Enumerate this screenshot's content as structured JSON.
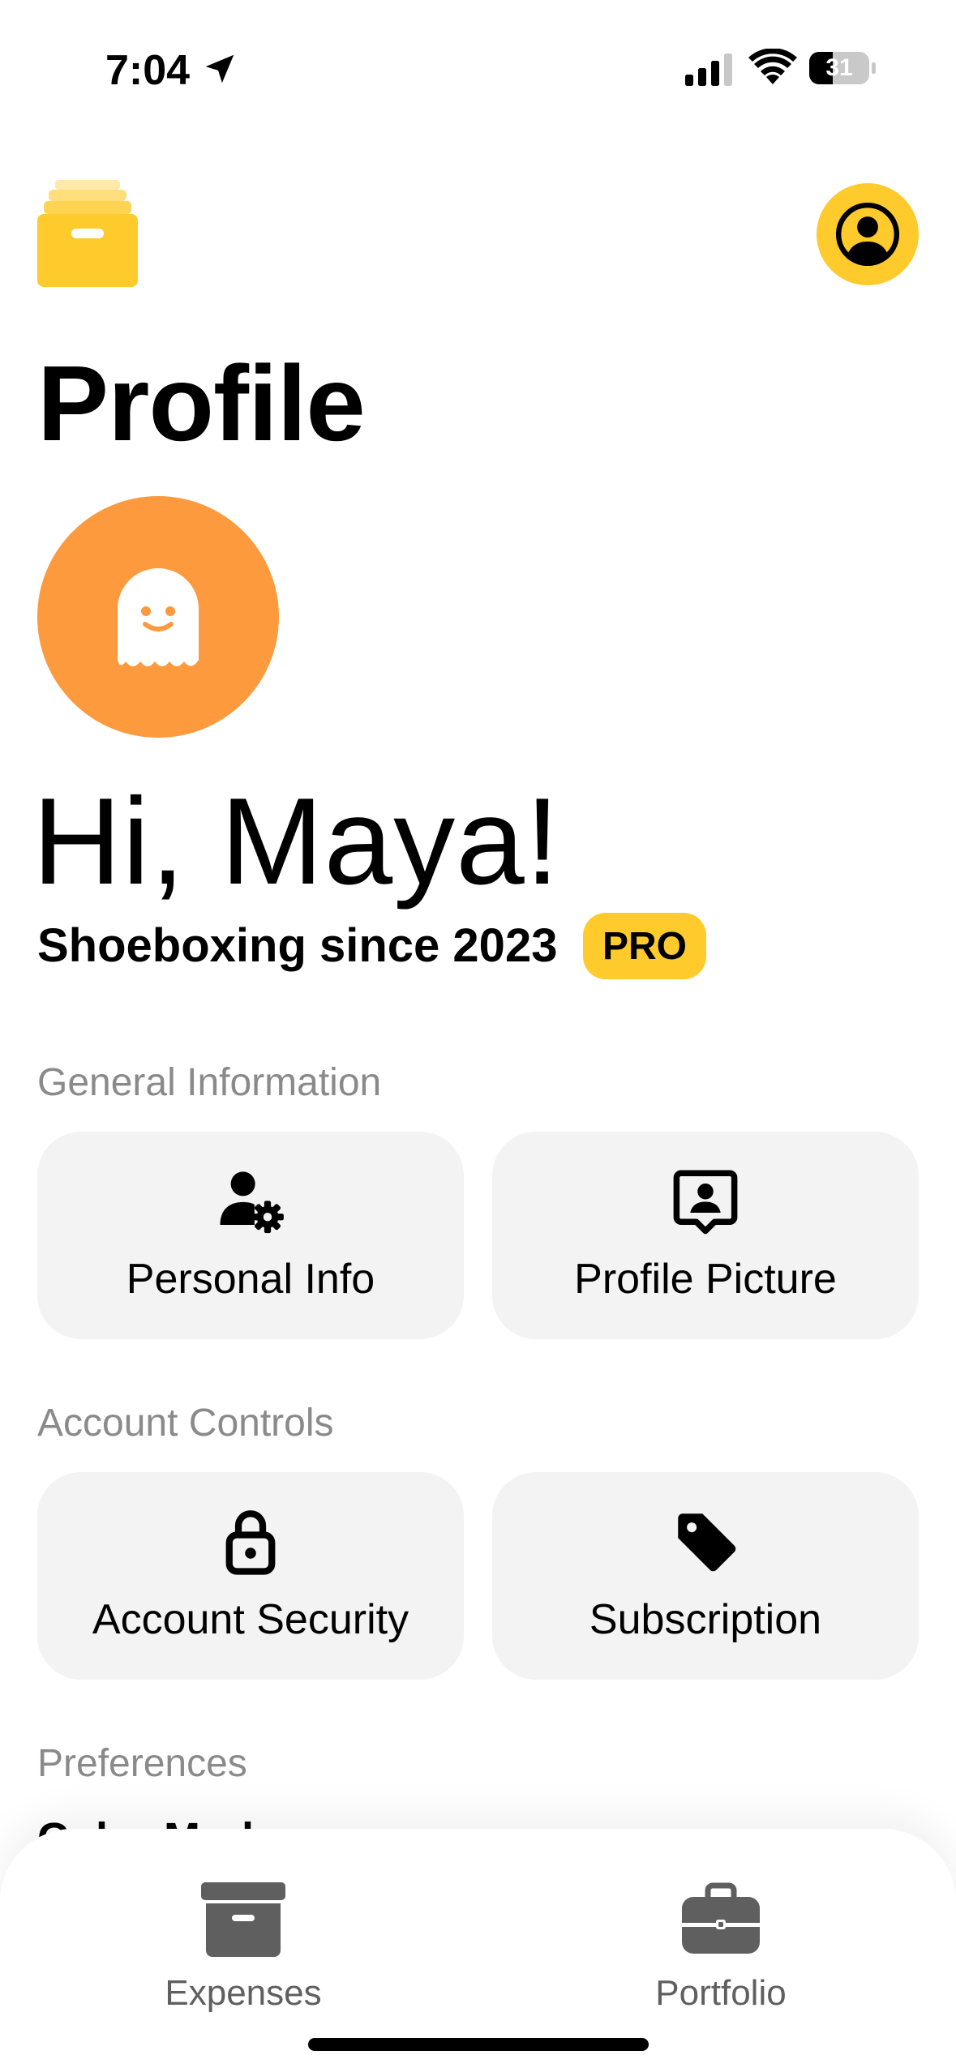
{
  "status_bar": {
    "time": "7:04",
    "battery": "31"
  },
  "header": {
    "title": "Profile"
  },
  "profile": {
    "greeting": "Hi, Maya!",
    "since": "Shoeboxing since 2023",
    "badge": "PRO"
  },
  "sections": {
    "general": {
      "label": "General Information",
      "tiles": [
        {
          "label": "Personal Info",
          "icon": "user-gear-icon"
        },
        {
          "label": "Profile Picture",
          "icon": "portrait-icon"
        }
      ]
    },
    "account": {
      "label": "Account Controls",
      "tiles": [
        {
          "label": "Account Security",
          "icon": "lock-icon"
        },
        {
          "label": "Subscription",
          "icon": "tag-icon"
        }
      ]
    },
    "preferences": {
      "label": "Preferences",
      "first_item": "Color Mode"
    }
  },
  "tabbar": {
    "tabs": [
      {
        "label": "Expenses",
        "icon": "archive-box-icon"
      },
      {
        "label": "Portfolio",
        "icon": "briefcase-icon"
      }
    ]
  },
  "colors": {
    "accent_yellow": "#FFCA2C",
    "avatar_orange": "#FD9A3E",
    "tile_bg": "#F3F3F3",
    "section_label": "#8A8A8A"
  }
}
